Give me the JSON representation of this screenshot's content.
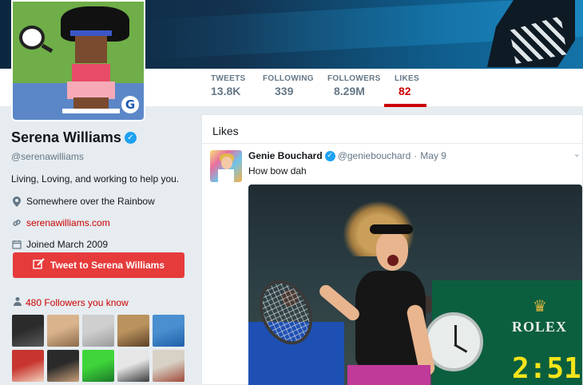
{
  "nav": {
    "tweets": {
      "label": "TWEETS",
      "value": "13.8K"
    },
    "following": {
      "label": "FOLLOWING",
      "value": "339"
    },
    "followers": {
      "label": "FOLLOWERS",
      "value": "8.29M"
    },
    "likes": {
      "label": "LIKES",
      "value": "82"
    }
  },
  "profile": {
    "name": "Serena Williams",
    "handle": "@serenawilliams",
    "bio": "Living, Loving, and working to help you.",
    "location": "Somewhere over the Rainbow",
    "website": "serenawilliams.com",
    "joined": "Joined March 2009",
    "tweet_button": "Tweet to Serena Williams",
    "followers_you_know": "480 Followers you know",
    "avatar_logo_glyph": "G"
  },
  "likes": {
    "header": "Likes",
    "tweet": {
      "name": "Genie Bouchard",
      "handle": "@geniebouchard",
      "separator": "·",
      "date": "May 9",
      "text": "How bow dah"
    }
  },
  "photo": {
    "sign_text": "ROLEX",
    "score_text": "2:51"
  },
  "follower_thumbs": [
    {
      "name": "thumb-1",
      "colors": [
        "#2b2b2b",
        "#5a5a5a"
      ]
    },
    {
      "name": "thumb-2",
      "colors": [
        "#d9b38c",
        "#8c6a4a"
      ]
    },
    {
      "name": "thumb-3",
      "colors": [
        "#cfcfcf",
        "#9a9a9a"
      ]
    },
    {
      "name": "thumb-4",
      "colors": [
        "#b9925e",
        "#5c4026"
      ]
    },
    {
      "name": "thumb-5",
      "colors": [
        "#4a8fd0",
        "#1f5fa8"
      ]
    },
    {
      "name": "thumb-6",
      "colors": [
        "#c7352e",
        "#f2d3c0"
      ]
    },
    {
      "name": "thumb-7",
      "colors": [
        "#2a2a2a",
        "#c9a07a"
      ]
    },
    {
      "name": "thumb-8",
      "colors": [
        "#3fd53a",
        "#1b7a2a"
      ]
    },
    {
      "name": "thumb-9",
      "colors": [
        "#e6e6e6",
        "#3a3a3a"
      ]
    },
    {
      "name": "thumb-10",
      "colors": [
        "#d8d2c6",
        "#a04a3a"
      ]
    }
  ],
  "colors": {
    "accent": "#cc0000",
    "verified": "#1da1f2",
    "tweet_button": "#e63b3b"
  }
}
